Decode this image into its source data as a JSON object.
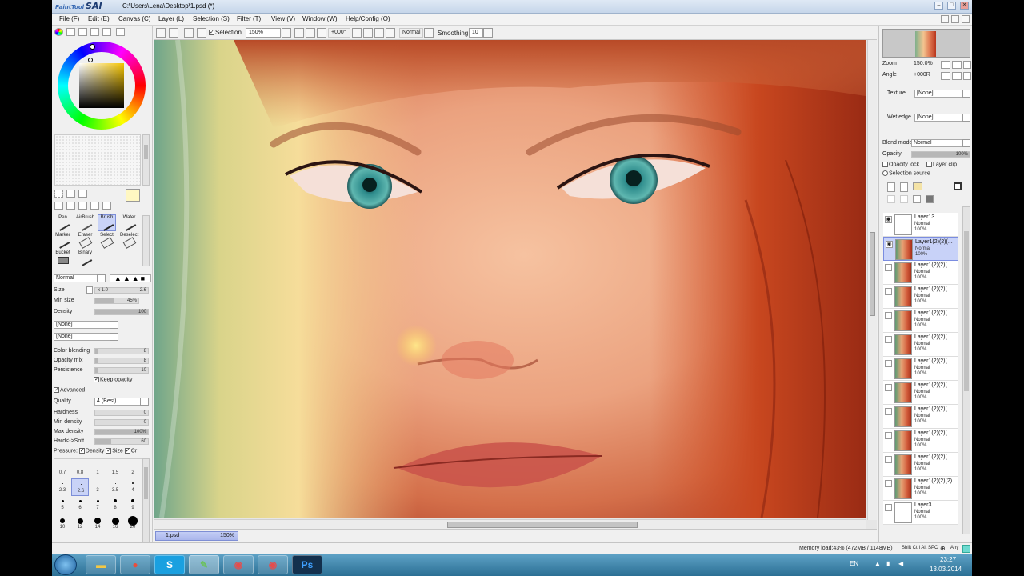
{
  "window": {
    "app_logo": "PaintTool SAI",
    "title": "C:\\Users\\Lena\\Desktop\\1.psd (*)"
  },
  "menu": [
    "File (F)",
    "Edit (E)",
    "Canvas (C)",
    "Layer (L)",
    "Selection (S)",
    "Filter (T)",
    "View (V)",
    "Window (W)",
    "Help/Config (O)"
  ],
  "options_bar": {
    "selection_label": "Selection",
    "selection_checked": true,
    "zoom": "150%",
    "rotation": "+000°",
    "blend": "Normal",
    "smoothing_label": "Smoothing",
    "smoothing_value": "10"
  },
  "tools": {
    "row1": [
      "Pen",
      "AirBrush",
      "Brush",
      "Water"
    ],
    "row2": [
      "Marker",
      "Eraser",
      "Select",
      "Deselect"
    ],
    "row3": [
      "Bucket",
      "Binary"
    ],
    "selected": "Brush"
  },
  "brush_settings": {
    "mode": "Normal",
    "size_label": "Size",
    "size_mult": "x 1.0",
    "size_value": "2.6",
    "min_size_label": "Min size",
    "min_size_value": "45%",
    "min_size_fraction": 0.45,
    "density_label": "Density",
    "density_value": "100",
    "texture1": "[None]",
    "texture2": "[None]",
    "color_blending_label": "Color blending",
    "color_blending_value": "8",
    "opacity_mix_label": "Opacity mix",
    "opacity_mix_value": "8",
    "persistence_label": "Persistence",
    "persistence_value": "10",
    "keep_opacity_label": "Keep opacity",
    "advanced_label": "Advanced",
    "quality_label": "Quality",
    "quality_value": "4 (Best)",
    "hardness_label": "Hardness",
    "hardness_value": "0",
    "min_density_label": "Min density",
    "min_density_value": "0",
    "max_density_label": "Max density",
    "max_density_value": "100%",
    "hard_soft_label": "Hard<->Soft",
    "hard_soft_value": "60",
    "pressure_label": "Pressure:",
    "pressure_density": "Density",
    "pressure_size": "Size",
    "pressure_cr": "Cr"
  },
  "brush_sizes": [
    [
      "0.7",
      "0.8",
      "1",
      "1.5",
      "2"
    ],
    [
      "2.3",
      "2.6",
      "3",
      "3.5",
      "4"
    ],
    [
      "5",
      "6",
      "7",
      "8",
      "9"
    ],
    [
      "10",
      "12",
      "14",
      "16",
      "20"
    ]
  ],
  "navigator": {
    "zoom_label": "Zoom",
    "zoom_value": "150.0%",
    "angle_label": "Angle",
    "angle_value": "+000R"
  },
  "layer_props": {
    "texture_label": "Texture",
    "texture_value": "[None]",
    "wet_edge_label": "Wet edge",
    "wet_edge_value": "[None]",
    "blend_mode_label": "Blend mode",
    "blend_mode_value": "Normal",
    "opacity_label": "Opacity",
    "opacity_value": "100%",
    "opacity_lock": "Opacity lock",
    "layer_clip": "Layer clip",
    "selection_source": "Selection source"
  },
  "layers": [
    {
      "name": "Layer13",
      "mode": "Normal",
      "opacity": "100%",
      "thumb": "white",
      "visible": true,
      "selected": false
    },
    {
      "name": "Layer1(2)(2)(...",
      "mode": "Normal",
      "opacity": "100%",
      "thumb": "face",
      "visible": true,
      "selected": true
    },
    {
      "name": "Layer1(2)(2)(...",
      "mode": "Normal",
      "opacity": "100%",
      "thumb": "face",
      "visible": false,
      "selected": false
    },
    {
      "name": "Layer1(2)(2)(...",
      "mode": "Normal",
      "opacity": "100%",
      "thumb": "face",
      "visible": false,
      "selected": false
    },
    {
      "name": "Layer1(2)(2)(...",
      "mode": "Normal",
      "opacity": "100%",
      "thumb": "face",
      "visible": false,
      "selected": false
    },
    {
      "name": "Layer1(2)(2)(...",
      "mode": "Normal",
      "opacity": "100%",
      "thumb": "face",
      "visible": false,
      "selected": false
    },
    {
      "name": "Layer1(2)(2)(...",
      "mode": "Normal",
      "opacity": "100%",
      "thumb": "face",
      "visible": false,
      "selected": false
    },
    {
      "name": "Layer1(2)(2)(...",
      "mode": "Normal",
      "opacity": "100%",
      "thumb": "face",
      "visible": false,
      "selected": false
    },
    {
      "name": "Layer1(2)(2)(...",
      "mode": "Normal",
      "opacity": "100%",
      "thumb": "face",
      "visible": false,
      "selected": false
    },
    {
      "name": "Layer1(2)(2)(...",
      "mode": "Normal",
      "opacity": "100%",
      "thumb": "face",
      "visible": false,
      "selected": false
    },
    {
      "name": "Layer1(2)(2)(...",
      "mode": "Normal",
      "opacity": "100%",
      "thumb": "face",
      "visible": false,
      "selected": false
    },
    {
      "name": "Layer1(2)(2)(2)",
      "mode": "Normal",
      "opacity": "100%",
      "thumb": "face",
      "visible": false,
      "selected": false
    },
    {
      "name": "Layer3",
      "mode": "Normal",
      "opacity": "100%",
      "thumb": "white",
      "visible": false,
      "selected": false
    }
  ],
  "doc_tab": {
    "name": "1.psd",
    "zoom": "150%"
  },
  "status": {
    "memory": "Memory load:43% (472MB / 1148MB)",
    "keys": "Shift Ctrl Alt SPC",
    "any": "Any"
  },
  "taskbar": {
    "apps": [
      "explorer",
      "chrome",
      "skype",
      "sai",
      "browser1",
      "browser2",
      "photoshop"
    ],
    "lang": "EN",
    "time": "23:27",
    "date": "13.03.2014"
  },
  "colors": {
    "accent_selection": "#c8d2f8",
    "title_bar": "#c6d6ea",
    "taskbar": "#2b6f94"
  }
}
